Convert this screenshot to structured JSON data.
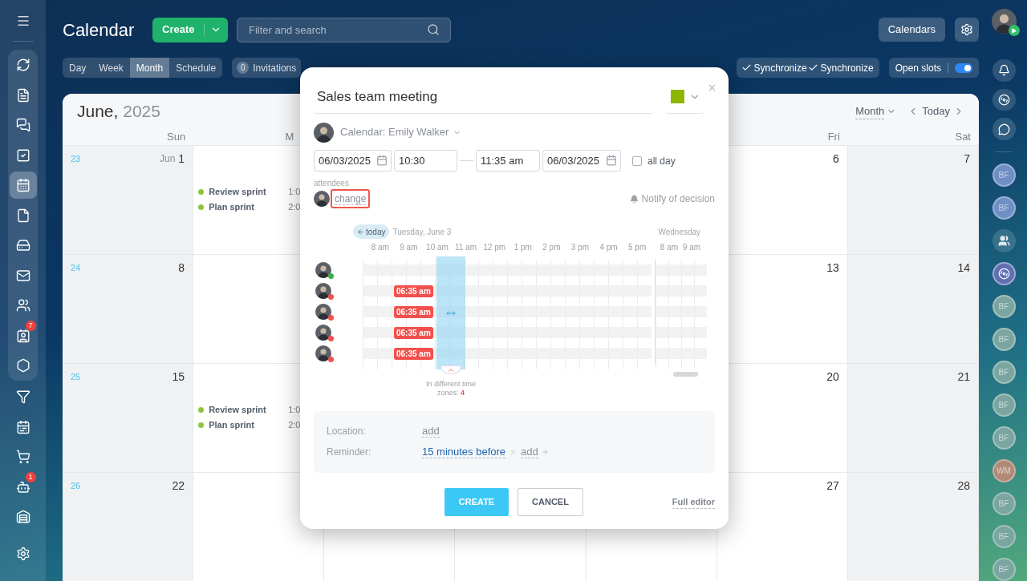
{
  "left_nav": {
    "menu": {
      "selected": false
    },
    "pinned_items": [
      {
        "selected": false
      },
      {
        "selected": false
      },
      {
        "selected": false
      },
      {
        "selected": false
      },
      {
        "selected": true
      },
      {
        "selected": false
      },
      {
        "selected": false
      },
      {
        "selected": false
      },
      {
        "selected": false
      },
      {
        "selected": false,
        "badge": "7"
      },
      {
        "selected": false
      }
    ],
    "items": [
      {
        "selected": false
      },
      {
        "selected": false
      },
      {
        "selected": false
      },
      {
        "selected": false,
        "badge": "1"
      },
      {
        "selected": false
      }
    ],
    "settings": {
      "selected": false
    }
  },
  "header": {
    "title": "Calendar",
    "create_button": "Create",
    "search": {
      "placeholder": "Filter and search"
    },
    "calendars_button": "Calendars"
  },
  "view_tabs": [
    {
      "label": "Day",
      "selected": false
    },
    {
      "label": "Week",
      "selected": false
    },
    {
      "label": "Month",
      "selected": true
    },
    {
      "label": "Schedule",
      "selected": false
    }
  ],
  "invitations": {
    "count": "0",
    "label": "Invitations"
  },
  "sync_buttons": [
    "Synchronize",
    "Synchronize"
  ],
  "open_slots": {
    "label": "Open slots",
    "on": true
  },
  "calendar": {
    "month": "June,",
    "year": "2025",
    "view_select": "Month",
    "today_button": "Today",
    "left_headers": [
      "Sun",
      "M"
    ],
    "right_headers": [
      "Fri",
      "Sat"
    ],
    "weeks": [
      {
        "week": "23",
        "left_days": [
          {
            "month": "Jun",
            "date": "1",
            "weekend": true
          },
          {
            "weekend": false,
            "events": [
              {
                "title": "Review sprint",
                "time": "1:0"
              },
              {
                "title": "Plan sprint",
                "time": "2:0"
              }
            ]
          }
        ],
        "right_days": [
          {
            "date": "6",
            "weekend": false
          },
          {
            "date": "7",
            "weekend": true
          }
        ]
      },
      {
        "week": "24",
        "left_days": [
          {
            "date": "8",
            "weekend": true
          }
        ],
        "right_days": [
          {
            "date": "13",
            "weekend": false
          },
          {
            "date": "14",
            "weekend": true
          }
        ]
      },
      {
        "week": "25",
        "left_days": [
          {
            "date": "15",
            "weekend": true
          },
          {
            "weekend": false,
            "events": [
              {
                "title": "Review sprint",
                "time": "1:0"
              },
              {
                "title": "Plan sprint",
                "time": "2:0"
              }
            ]
          }
        ],
        "right_days": [
          {
            "date": "20",
            "weekend": false
          },
          {
            "date": "21",
            "weekend": true
          }
        ]
      },
      {
        "week": "26",
        "left_days": [
          {
            "date": "22",
            "weekend": true
          }
        ],
        "right_days": [
          {
            "date": "27",
            "weekend": false
          },
          {
            "date": "28",
            "weekend": true
          }
        ]
      }
    ]
  },
  "event_dialog": {
    "title": "Sales team meeting",
    "color": "#8db600",
    "calendar_label": "Calendar: Emily Walker",
    "start_date": "06/03/2025",
    "start_time": "10:30",
    "end_time": "11:35 am",
    "end_date": "06/03/2025",
    "all_day": {
      "label": "all day",
      "checked": false
    },
    "attendees_label": "attendees",
    "change_link": "change",
    "notify": "Notify of decision",
    "planner": {
      "today_button": "today",
      "day_label": "Tuesday, June 3",
      "next_day_label": "Wednesday",
      "hours": [
        "8 am",
        "9 am",
        "10 am",
        "11 am",
        "12 pm",
        "1 pm",
        "2 pm",
        "3 pm",
        "4 pm",
        "5 pm"
      ],
      "next_hours": [
        "8 am",
        "9 am"
      ],
      "attendees": [
        {
          "color": "#3fae49"
        },
        {
          "color": "#f0504f",
          "local_time": "06:35 am"
        },
        {
          "color": "#f0504f",
          "local_time": "06:35 am"
        },
        {
          "color": "#f0504f",
          "local_time": "06:35 am"
        },
        {
          "color": "#f0504f",
          "local_time": "06:35 am"
        }
      ],
      "timezone_note": "In different time",
      "timezone_note_2": "zones:",
      "timezone_count": "4"
    },
    "location": {
      "label": "Location:",
      "value": "add"
    },
    "reminder": {
      "label": "Reminder:",
      "value": "15 minutes before",
      "add": "add"
    },
    "create_button": "CREATE",
    "cancel_button": "CANCEL",
    "full_editor": "Full editor"
  },
  "right_bar": {
    "items": [
      {
        "kind": "initials",
        "initials": "BF",
        "color": "#6f8fc4"
      },
      {
        "kind": "initials",
        "initials": "BF",
        "color": "#6f8fc4"
      },
      {
        "kind": "group"
      },
      {
        "kind": "channel"
      },
      {
        "kind": "initials",
        "initials": "BF",
        "color": "#7aa5a0"
      },
      {
        "kind": "initials",
        "initials": "BF",
        "color": "#7aa5a0"
      },
      {
        "kind": "initials",
        "initials": "BF",
        "color": "#7aa5a0"
      },
      {
        "kind": "initials",
        "initials": "BF",
        "color": "#7aa5a0"
      },
      {
        "kind": "initials",
        "initials": "BF",
        "color": "#7aa5a0"
      },
      {
        "kind": "initials",
        "initials": "WM",
        "color": "#b08a78"
      },
      {
        "kind": "initials",
        "initials": "BF",
        "color": "#7aa5a0"
      },
      {
        "kind": "initials",
        "initials": "BF",
        "color": "#7aa5a0"
      },
      {
        "kind": "initials",
        "initials": "BF",
        "color": "#7aa5a0"
      }
    ]
  }
}
